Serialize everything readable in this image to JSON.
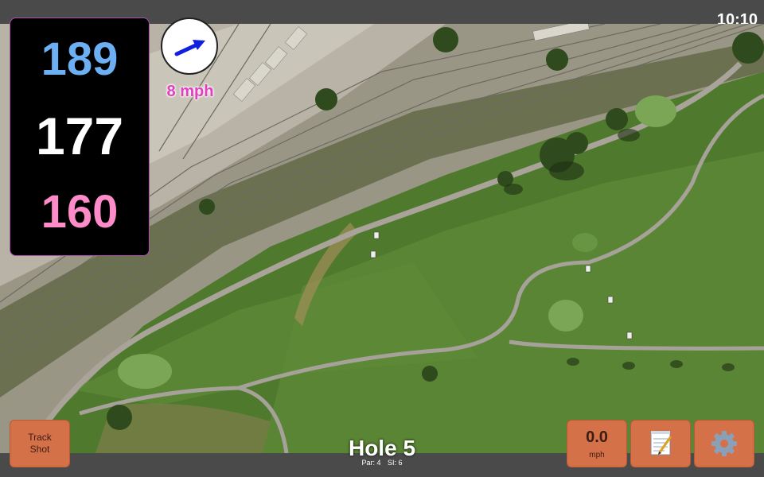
{
  "status": {
    "time": "10:10"
  },
  "yardages": {
    "back": "189",
    "middle": "177",
    "front": "160"
  },
  "wind": {
    "label": "8 mph",
    "icon": "wind-direction-arrow-icon"
  },
  "hole": {
    "title": "Hole 5",
    "par": "Par: 4",
    "si": "SI: 6"
  },
  "buttons": {
    "track_line1": "Track",
    "track_line2": "Shot",
    "wind_value": "0.0",
    "wind_unit": "mph",
    "notes_icon": "notepad-icon",
    "settings_icon": "gear-icon"
  },
  "colors": {
    "back": "#6cb0f3",
    "middle": "#ffffff",
    "front": "#ff8cc8",
    "button": "#d47148",
    "wind_text": "#e040c0",
    "arrow": "#1020e0"
  }
}
